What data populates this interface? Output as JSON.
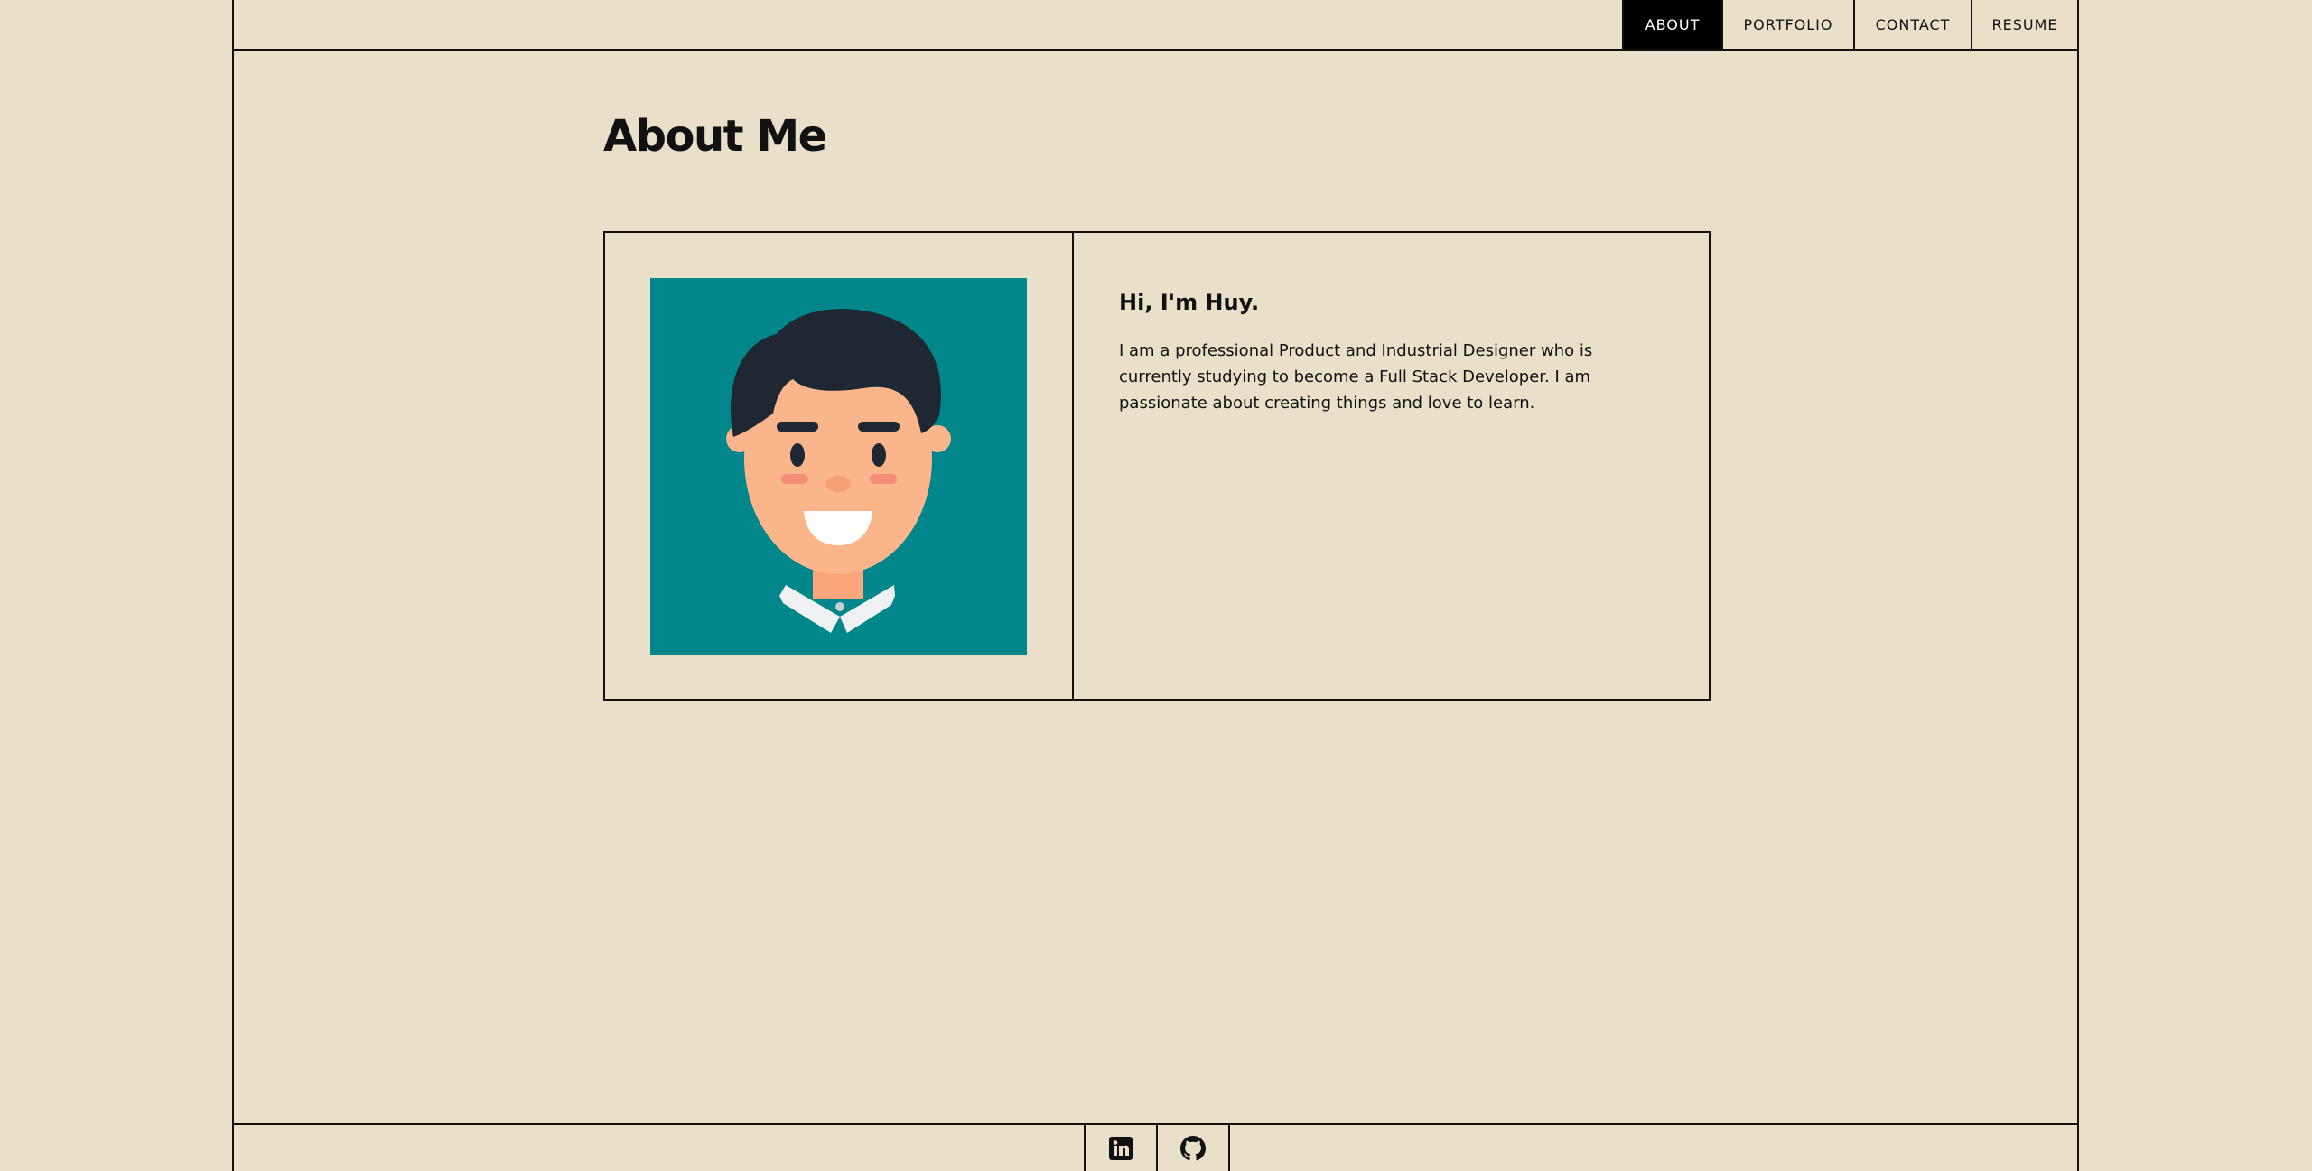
{
  "nav": {
    "items": [
      {
        "label": "ABOUT",
        "active": true
      },
      {
        "label": "PORTFOLIO",
        "active": false
      },
      {
        "label": "CONTACT",
        "active": false
      },
      {
        "label": "RESUME",
        "active": false
      }
    ]
  },
  "main": {
    "title": "About Me",
    "card": {
      "avatar_icon": "cartoon-man-avatar",
      "greeting": "Hi, I'm Huy.",
      "bio": "I am a professional Product and Industrial Designer who is currently studying to become a Full Stack Developer. I am passionate about creating things and love to learn."
    }
  },
  "footer": {
    "social": [
      {
        "icon": "linkedin-icon"
      },
      {
        "icon": "github-icon"
      }
    ]
  },
  "colors": {
    "background": "#e8e0c8",
    "border": "#111111",
    "nav_active_bg": "#000000",
    "avatar_bg": "#00868b"
  }
}
